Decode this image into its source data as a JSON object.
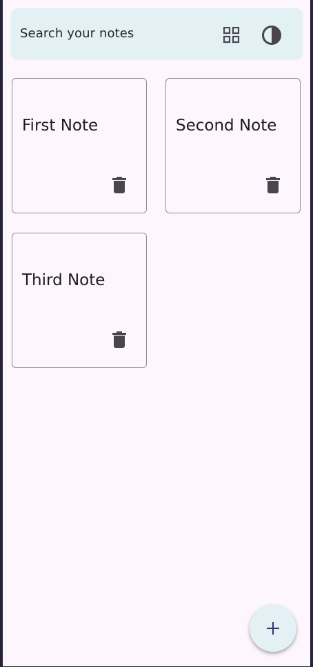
{
  "search": {
    "placeholder": "Search your notes",
    "grid_icon": "grid-view-icon",
    "theme_icon": "contrast-icon"
  },
  "notes": [
    {
      "title": "First Note",
      "delete_icon": "trash-icon"
    },
    {
      "title": "Second Note",
      "delete_icon": "trash-icon"
    },
    {
      "title": "Third Note",
      "delete_icon": "trash-icon"
    }
  ],
  "fab": {
    "icon": "plus-icon"
  },
  "colors": {
    "background": "#fdf6fd",
    "search_bar": "#e3f0f4",
    "card_border": "#8f8c92",
    "icon": "#49454f",
    "fab_icon": "#3b2f7a"
  }
}
